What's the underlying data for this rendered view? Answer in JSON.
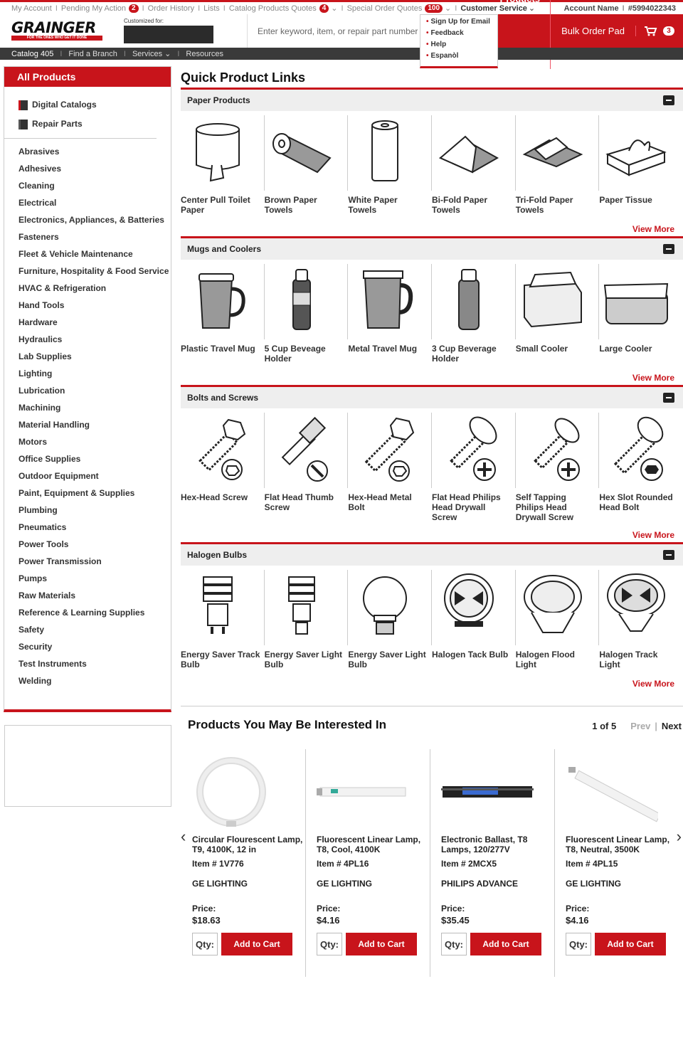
{
  "topbar": {
    "my_account": "My Account",
    "pending": "Pending My Action",
    "pending_count": "2",
    "order_history": "Order History",
    "lists": "Lists",
    "catalog_quotes": "Catalog Products Quotes",
    "catalog_quotes_count": "4",
    "special_quotes": "Special Order Quotes",
    "special_quotes_count": "100",
    "customer_service": "Customer Service",
    "account_name": "Account Name",
    "account_number": "#5994022343"
  },
  "dropdown": {
    "items": [
      "Sign Up for Email",
      "Feedback",
      "Help",
      "Espanòl"
    ]
  },
  "header": {
    "logo": "GRAINGER",
    "logo_tag": "FOR THE ONES WHO GET IT DONE",
    "customized_for": "Customized for:",
    "search_placeholder": "Enter keyword, item, or repair part number",
    "products": "Products",
    "bulk_order": "Bulk Order Pad",
    "cart_count": "3"
  },
  "nav": {
    "catalog": "Catalog 405",
    "find_branch": "Find a Branch",
    "services": "Services",
    "resources": "Resources"
  },
  "sidebar": {
    "title": "All Products",
    "top_links": [
      "Digital Catalogs",
      "Repair Parts"
    ],
    "categories": [
      "Abrasives",
      "Adhesives",
      "Cleaning",
      "Electrical",
      "Electronics, Appliances, & Batteries",
      "Fasteners",
      "Fleet & Vehicle Maintenance",
      "Furniture, Hospitality & Food Service",
      "HVAC & Refrigeration",
      "Hand Tools",
      "Hardware",
      "Hydraulics",
      "Lab Supplies",
      "Lighting",
      "Lubrication",
      "Machining",
      "Material Handling",
      "Motors",
      "Office Supplies",
      "Outdoor Equipment",
      "Paint, Equipment & Supplies",
      "Plumbing",
      "Pneumatics",
      "Power Tools",
      "Power Transmission",
      "Pumps",
      "Raw Materials",
      "Reference & Learning Supplies",
      "Safety",
      "Security",
      "Test Instruments",
      "Welding"
    ]
  },
  "main": {
    "title": "Quick Product Links",
    "view_more": "View More",
    "sections": [
      {
        "title": "Paper Products",
        "items": [
          "Center Pull Toilet Paper",
          "Brown Paper Towels",
          "White Paper Towels",
          "Bi-Fold Paper Towels",
          "Tri-Fold Paper Towels",
          "Paper Tissue"
        ]
      },
      {
        "title": "Mugs and Coolers",
        "items": [
          "Plastic Travel Mug",
          "5 Cup Beveage Holder",
          "Metal Travel Mug",
          "3 Cup Beverage Holder",
          "Small Cooler",
          "Large Cooler"
        ]
      },
      {
        "title": "Bolts and Screws",
        "items": [
          "Hex-Head Screw",
          "Flat Head Thumb Screw",
          "Hex-Head Metal Bolt",
          "Flat Head Philips Head Drywall Screw",
          "Self Tapping Philips Head Drywall Screw",
          "Hex Slot Rounded Head Bolt"
        ]
      },
      {
        "title": "Halogen Bulbs",
        "items": [
          "Energy Saver Track Bulb",
          "Energy Saver Light Bulb",
          "Energy Saver Light Bulb",
          "Halogen Tack Bulb",
          "Halogen Flood Light",
          "Halogen Track Light"
        ]
      }
    ]
  },
  "recommend": {
    "title": "Products You May Be Interested In",
    "page": "1 of 5",
    "prev": "Prev",
    "next": "Next",
    "price_label": "Price:",
    "qty_label": "Qty:",
    "add_to_cart": "Add to Cart",
    "items": [
      {
        "name": "Circular Flourescent Lamp, T9, 4100K, 12 in",
        "item": "Item # 1V776",
        "brand": "GE LIGHTING",
        "price": "$18.63"
      },
      {
        "name": "Fluorescent Linear Lamp, T8, Cool, 4100K",
        "item": "Item # 4PL16",
        "brand": "GE LIGHTING",
        "price": "$4.16"
      },
      {
        "name": "Electronic Ballast, T8 Lamps, 120/277V",
        "item": "Item # 2MCX5",
        "brand": "PHILIPS ADVANCE",
        "price": "$35.45"
      },
      {
        "name": "Fluorescent Linear Lamp, T8, Neutral, 3500K",
        "item": "Item # 4PL15",
        "brand": "GE LIGHTING",
        "price": "$4.16"
      }
    ]
  }
}
